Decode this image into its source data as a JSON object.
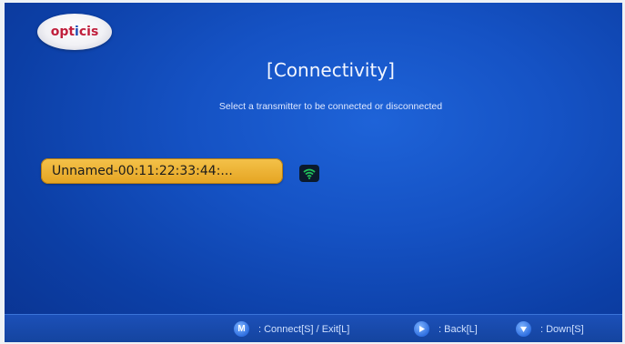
{
  "logo": {
    "text_a": "opt",
    "text_b": "i",
    "text_c": "cis"
  },
  "header": {
    "title": "[Connectivity]",
    "subtitle": "Select a transmitter to be connected or disconnected"
  },
  "devices": [
    {
      "label": "Unnamed-00:11:22:33:44:...",
      "status_icon": "wifi-signal-icon"
    }
  ],
  "footer": {
    "hints": [
      {
        "key": "M",
        "key_icon": "m-key-icon",
        "label": ": Connect[S] / Exit[L]"
      },
      {
        "key": "",
        "key_icon": "right-arrow-key-icon",
        "label": ": Back[L]"
      },
      {
        "key": "",
        "key_icon": "down-arrow-key-icon",
        "label": ": Down[S]"
      }
    ]
  },
  "colors": {
    "background": "#1552c4",
    "selected_item": "#e9ab2a",
    "logo_red": "#c01f3c",
    "signal_green": "#22c35a"
  }
}
